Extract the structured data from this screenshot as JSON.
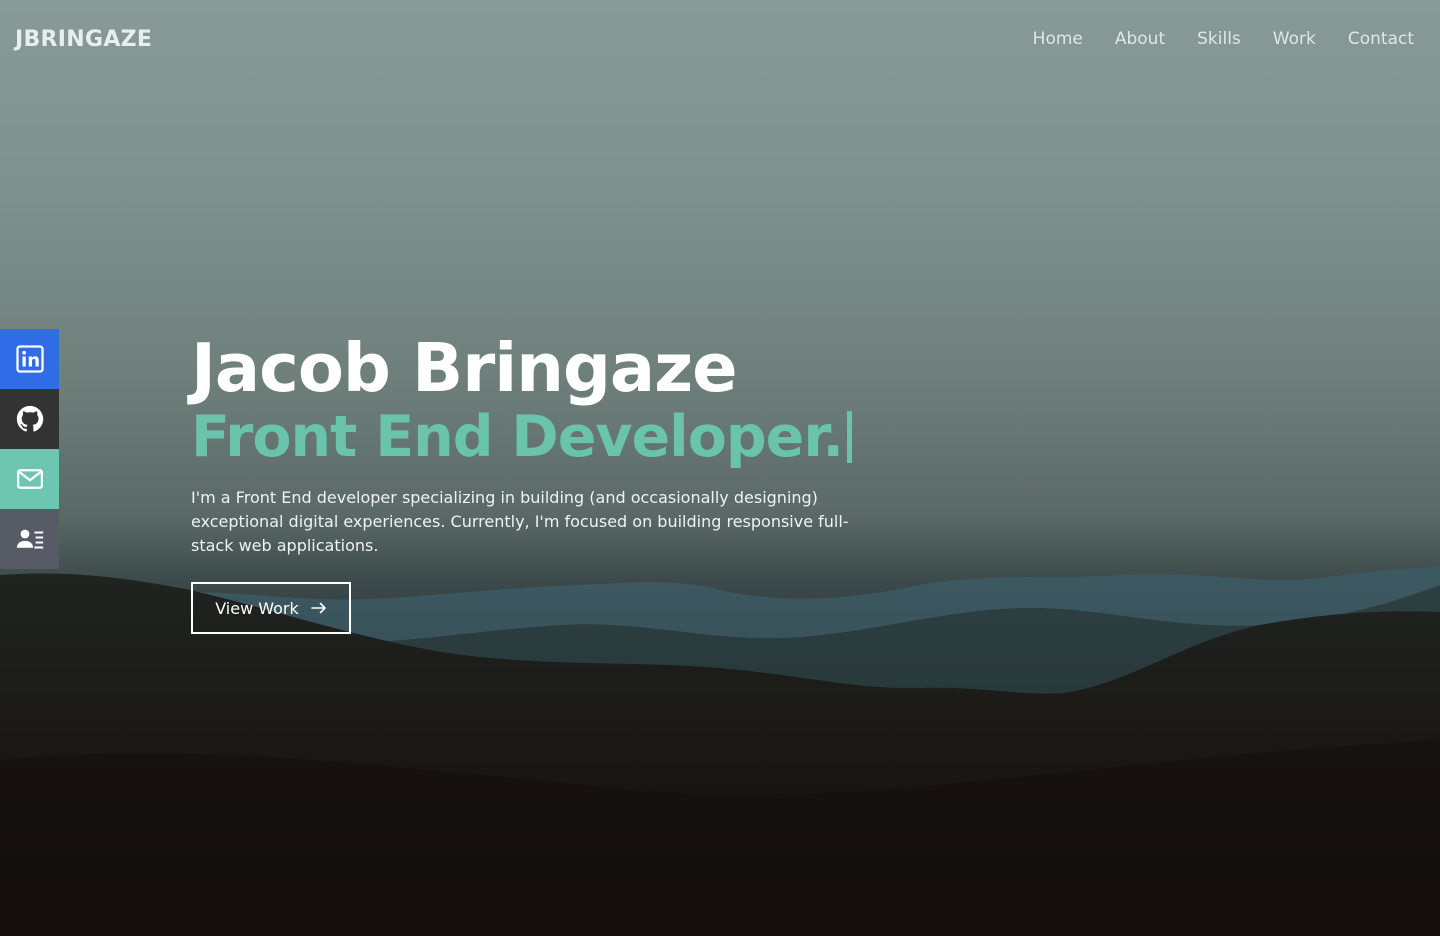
{
  "header": {
    "brand": "JBRINGAZE",
    "nav": [
      "Home",
      "About",
      "Skills",
      "Work",
      "Contact"
    ]
  },
  "social": [
    {
      "name": "linkedin",
      "icon": "linkedin-icon",
      "color": "#2f6ce5"
    },
    {
      "name": "github",
      "icon": "github-icon",
      "color": "#333333"
    },
    {
      "name": "email",
      "icon": "mail-icon",
      "color": "#6ec5b0"
    },
    {
      "name": "resume",
      "icon": "contact-card-icon",
      "color": "#565b66"
    }
  ],
  "hero": {
    "name": "Jacob Bringaze",
    "role": "Front End Developer.",
    "intro": "I'm a Front End developer specializing in building (and occasionally designing) exceptional digital experiences. Currently, I'm focused on building responsive full-stack web applications.",
    "cta_label": "View Work"
  },
  "colors": {
    "accent": "#6ac3ab",
    "linkedin": "#2f6ce5",
    "github": "#333333",
    "email": "#6ec5b0",
    "resume": "#565b66"
  }
}
